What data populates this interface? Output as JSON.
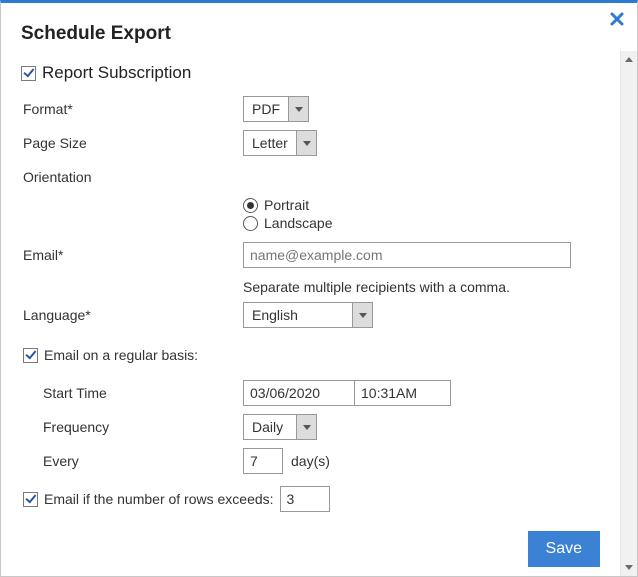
{
  "dialog": {
    "title": "Schedule Export"
  },
  "section": {
    "report_subscription_label": "Report Subscription",
    "report_subscription_checked": true
  },
  "format": {
    "label": "Format*",
    "value": "PDF"
  },
  "page_size": {
    "label": "Page Size",
    "value": "Letter"
  },
  "orientation": {
    "label": "Orientation",
    "options": {
      "portrait": "Portrait",
      "landscape": "Landscape"
    },
    "selected": "portrait"
  },
  "email": {
    "label": "Email*",
    "placeholder": "name@example.com",
    "value": "",
    "hint": "Separate multiple recipients with a comma."
  },
  "language": {
    "label": "Language*",
    "value": "English"
  },
  "schedule": {
    "regular_label": "Email on a regular basis:",
    "regular_checked": true,
    "start_time_label": "Start Time",
    "start_date": "03/06/2020",
    "start_time": "10:31AM",
    "frequency_label": "Frequency",
    "frequency_value": "Daily",
    "every_label": "Every",
    "every_value": "7",
    "every_unit": "day(s)"
  },
  "threshold": {
    "label": "Email if the number of rows exceeds:",
    "checked": true,
    "value": "3"
  },
  "actions": {
    "save": "Save"
  }
}
